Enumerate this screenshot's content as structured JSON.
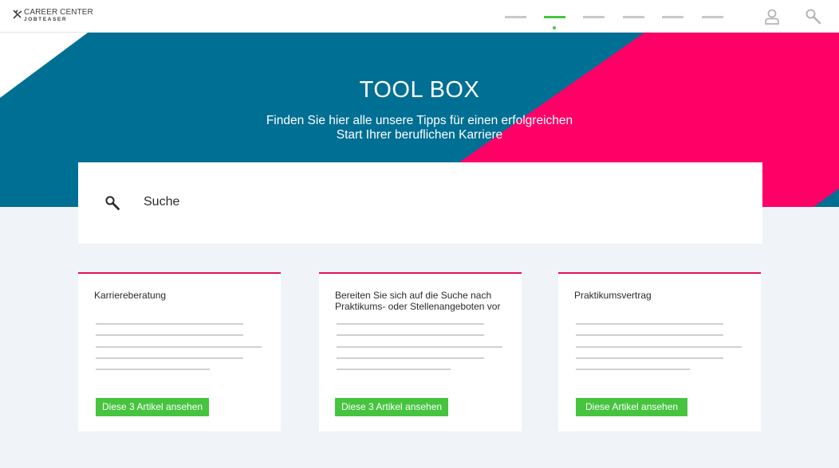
{
  "logo": {
    "title": "CAREER CENTER",
    "subtitle": "JOBTEASER"
  },
  "nav": {
    "item_count": 6,
    "active_index": 1
  },
  "hero": {
    "title": "TOOL BOX",
    "subtitle": "Finden Sie hier alle unsere Tipps für einen erfolgreichen Start Ihrer beruflichen Karriere"
  },
  "search": {
    "placeholder": "Suche"
  },
  "cards": [
    {
      "title": "Karriereberatung",
      "button": "Diese 3 Artikel ansehen"
    },
    {
      "title": "Bereiten Sie sich auf die Suche nach Praktikums- oder Stellenangeboten vor",
      "button": "Diese 3 Artikel ansehen"
    },
    {
      "title": "Praktikumsvertrag",
      "button": "Diese Artikel ansehen"
    }
  ],
  "colors": {
    "teal": "#006f94",
    "pink": "#ff0066",
    "accent_green": "#47c43f",
    "card_border": "#e3105c",
    "background": "#f0f4f8"
  },
  "icons": [
    "logo-mark-icon",
    "user-icon",
    "search-icon"
  ]
}
